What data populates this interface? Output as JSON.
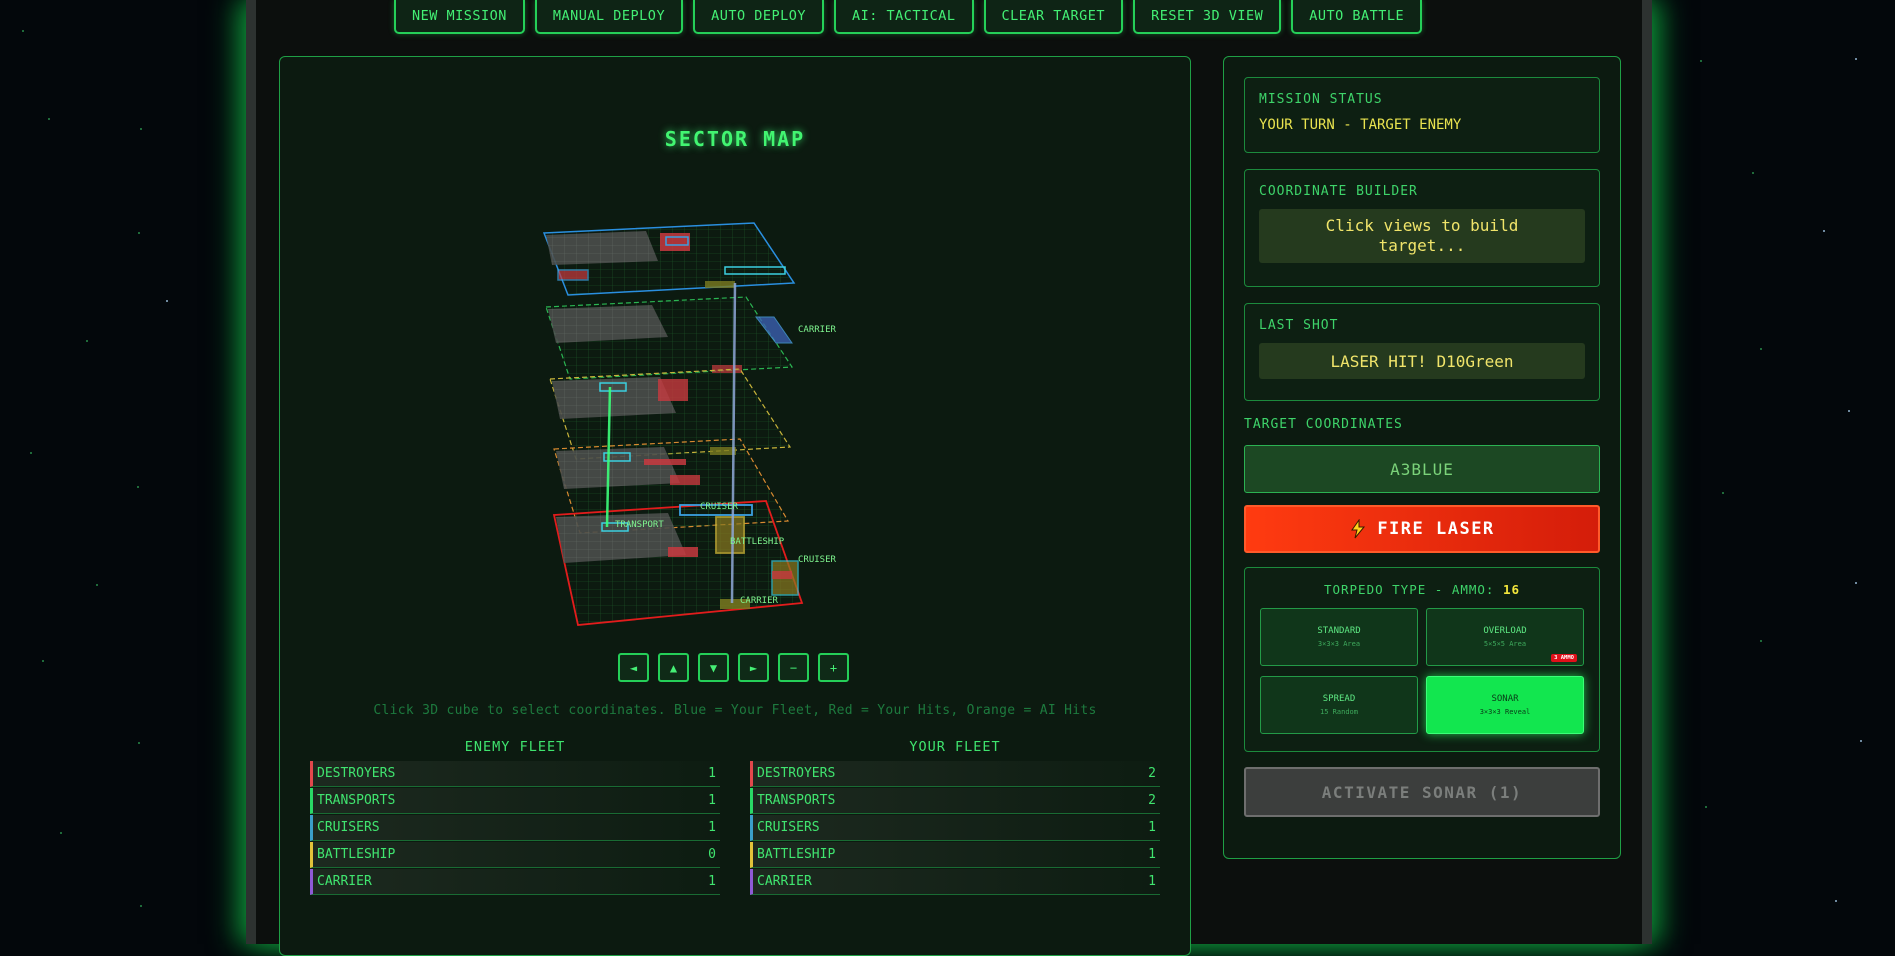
{
  "toolbar": {
    "new_mission": "NEW MISSION",
    "manual_deploy": "MANUAL DEPLOY",
    "auto_deploy": "AUTO DEPLOY",
    "ai_tactical": "AI: TACTICAL",
    "clear_target": "CLEAR TARGET",
    "reset_view": "RESET 3D VIEW",
    "auto_battle": "AUTO BATTLE"
  },
  "map": {
    "title": "SECTOR MAP",
    "labels": {
      "carrier_top": "CARRIER",
      "transport": "TRANSPORT",
      "cruiser_mid": "CRUISER",
      "battleship": "BATTLESHIP",
      "cruiser_right": "CRUISER",
      "carrier_bottom": "CARRIER"
    },
    "nav": {
      "left": "◄",
      "up": "▲",
      "down": "▼",
      "right": "►",
      "zoom_out": "−",
      "zoom_in": "+"
    },
    "hint": "Click 3D cube to select coordinates. Blue = Your Fleet, Red = Your Hits, Orange = AI Hits"
  },
  "enemy_fleet": {
    "title": "ENEMY FLEET",
    "rows": [
      {
        "name": "DESTROYERS",
        "count": "1"
      },
      {
        "name": "TRANSPORTS",
        "count": "1"
      },
      {
        "name": "CRUISERS",
        "count": "1"
      },
      {
        "name": "BATTLESHIP",
        "count": "0"
      },
      {
        "name": "CARRIER",
        "count": "1"
      }
    ]
  },
  "your_fleet": {
    "title": "YOUR FLEET",
    "rows": [
      {
        "name": "DESTROYERS",
        "count": "2"
      },
      {
        "name": "TRANSPORTS",
        "count": "2"
      },
      {
        "name": "CRUISERS",
        "count": "1"
      },
      {
        "name": "BATTLESHIP",
        "count": "1"
      },
      {
        "name": "CARRIER",
        "count": "1"
      }
    ]
  },
  "fleet_colors": [
    "#e2484c",
    "#29d965",
    "#3b9fc9",
    "#e0c23a",
    "#8e5ad6"
  ],
  "status": {
    "mission_label": "MISSION STATUS",
    "mission_value": "YOUR TURN - TARGET ENEMY",
    "builder_label": "COORDINATE BUILDER",
    "builder_value": "Click views to build target...",
    "last_shot_label": "LAST SHOT",
    "last_shot_value": "LASER HIT! D10Green",
    "target_label": "TARGET COORDINATES",
    "target_value": "A3BLUE",
    "fire_label": "FIRE LASER",
    "fire_icon": "lightning-icon"
  },
  "torpedo": {
    "label": "TORPEDO TYPE - AMMO:",
    "ammo": "16",
    "types": [
      {
        "name": "STANDARD",
        "sub": "3×3×3 Area"
      },
      {
        "name": "OVERLOAD",
        "sub": "5×5×5 Area",
        "badge": "3 AMMO"
      },
      {
        "name": "SPREAD",
        "sub": "15 Random"
      },
      {
        "name": "SONAR",
        "sub": "3×3×3 Reveal"
      }
    ],
    "selected": "SONAR"
  },
  "sonar_button": "ACTIVATE SONAR (1)"
}
